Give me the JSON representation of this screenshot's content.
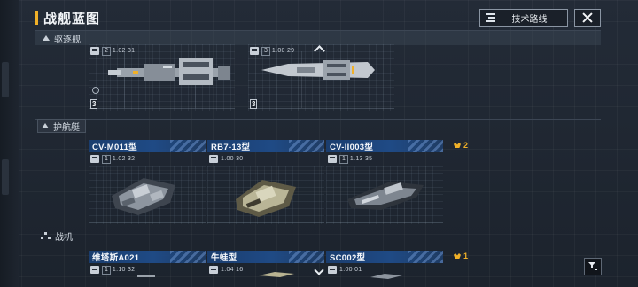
{
  "header": {
    "title": "战舰蓝图",
    "tech_tree_label": "技术路线"
  },
  "sections": {
    "destroyer": {
      "label": "驱逐舰"
    },
    "frigate": {
      "label": "护航艇"
    },
    "fighter": {
      "label": "战机"
    }
  },
  "destroyer_cards": [
    {
      "stat_num": "2",
      "stat_val": "1.02 31",
      "level": "3"
    },
    {
      "stat_num": "3",
      "stat_val": "1.00 29",
      "level": "3"
    }
  ],
  "frigate_cards": [
    {
      "name": "CV-M011型",
      "tier": "2",
      "stat_num": "1",
      "stat_val": "1.02 32"
    },
    {
      "name": "RB7-13型",
      "tier": "2",
      "stat_num": "",
      "stat_val": "1.00 30"
    },
    {
      "name": "CV-II003型",
      "tier": "2",
      "stat_num": "1",
      "stat_val": "1.13 35"
    }
  ],
  "fighter_cards": [
    {
      "name": "维塔斯A021",
      "tier": "1",
      "stat_num": "1",
      "stat_val": "1.10 32"
    },
    {
      "name": "牛蛙型",
      "tier": "1",
      "stat_num": "",
      "stat_val": "1.04 16"
    },
    {
      "name": "SC002型",
      "tier": "1",
      "stat_num": "",
      "stat_val": "1.00 01"
    }
  ],
  "colors": {
    "accent_gold": "#f0b028",
    "card_header_blue": "#1f4a85",
    "background": "#1f2631"
  },
  "icons": [
    "tech-tree-icon",
    "close-icon",
    "filter-icon",
    "chevron-up-icon",
    "chevron-down-icon",
    "tier-crown-icon"
  ]
}
